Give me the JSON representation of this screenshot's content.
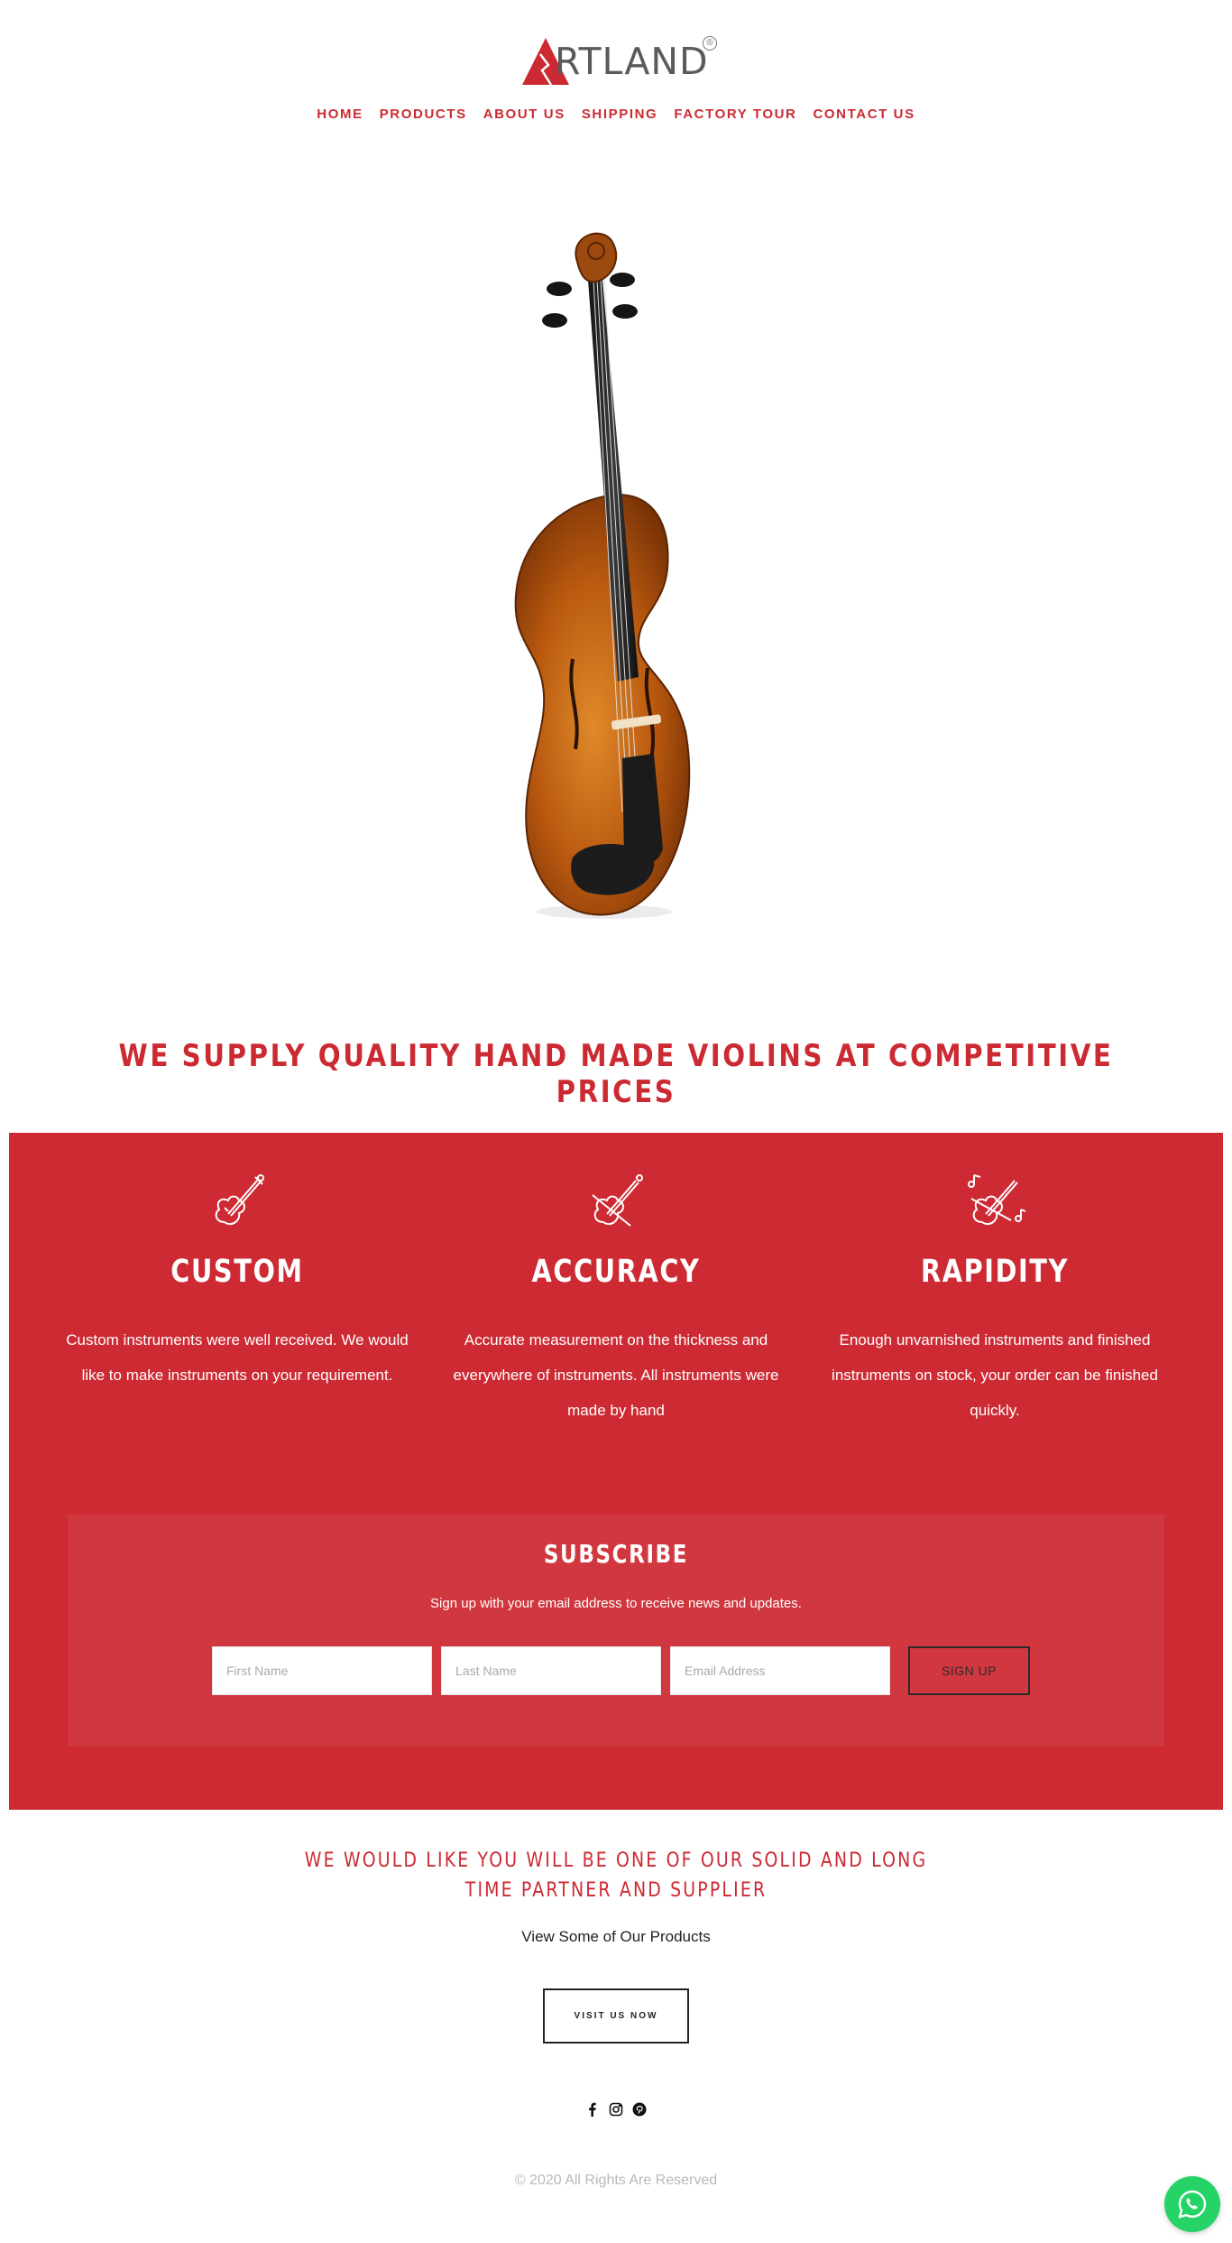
{
  "header": {
    "logo_text": "RTLAND",
    "logo_reg": "®",
    "nav": [
      "HOME",
      "PRODUCTS",
      "ABOUT US",
      "SHIPPING",
      "FACTORY TOUR",
      "CONTACT US"
    ]
  },
  "headline": "WE SUPPLY QUALITY HAND MADE VIOLINS AT COMPETITIVE PRICES",
  "features": [
    {
      "title": "CUSTOM",
      "icon": "violin-icon",
      "desc": "Custom instruments were well received. We would like to make instruments on your requirement."
    },
    {
      "title": "ACCURACY",
      "icon": "violin-measure-icon",
      "desc": "Accurate measurement on the thickness and everywhere of instruments.  All instruments were made by hand"
    },
    {
      "title": "RAPIDITY",
      "icon": "violin-notes-icon",
      "desc": "Enough unvarnished instruments and finished instruments on stock, your order can be finished quickly."
    }
  ],
  "subscribe": {
    "title": "SUBSCRIBE",
    "text": "Sign up with your email address to receive news and updates.",
    "first_name_placeholder": "First Name",
    "last_name_placeholder": "Last Name",
    "email_placeholder": "Email Address",
    "button": "SIGN UP"
  },
  "partner": {
    "line1": "WE WOULD LIKE YOU WILL BE ONE OF OUR SOLID AND LONG",
    "line2": "TIME PARTNER AND SUPPLIER"
  },
  "view_products": "View Some of Our Products",
  "visit_button": "VISIT US NOW",
  "social": [
    "facebook-icon",
    "instagram-icon",
    "pinterest-icon"
  ],
  "copyright": "© 2020 All Rights Are Reserved",
  "colors": {
    "brand_red": "#cd2a33",
    "subscribe_bg": "#d1373e",
    "whatsapp": "#25d366"
  }
}
